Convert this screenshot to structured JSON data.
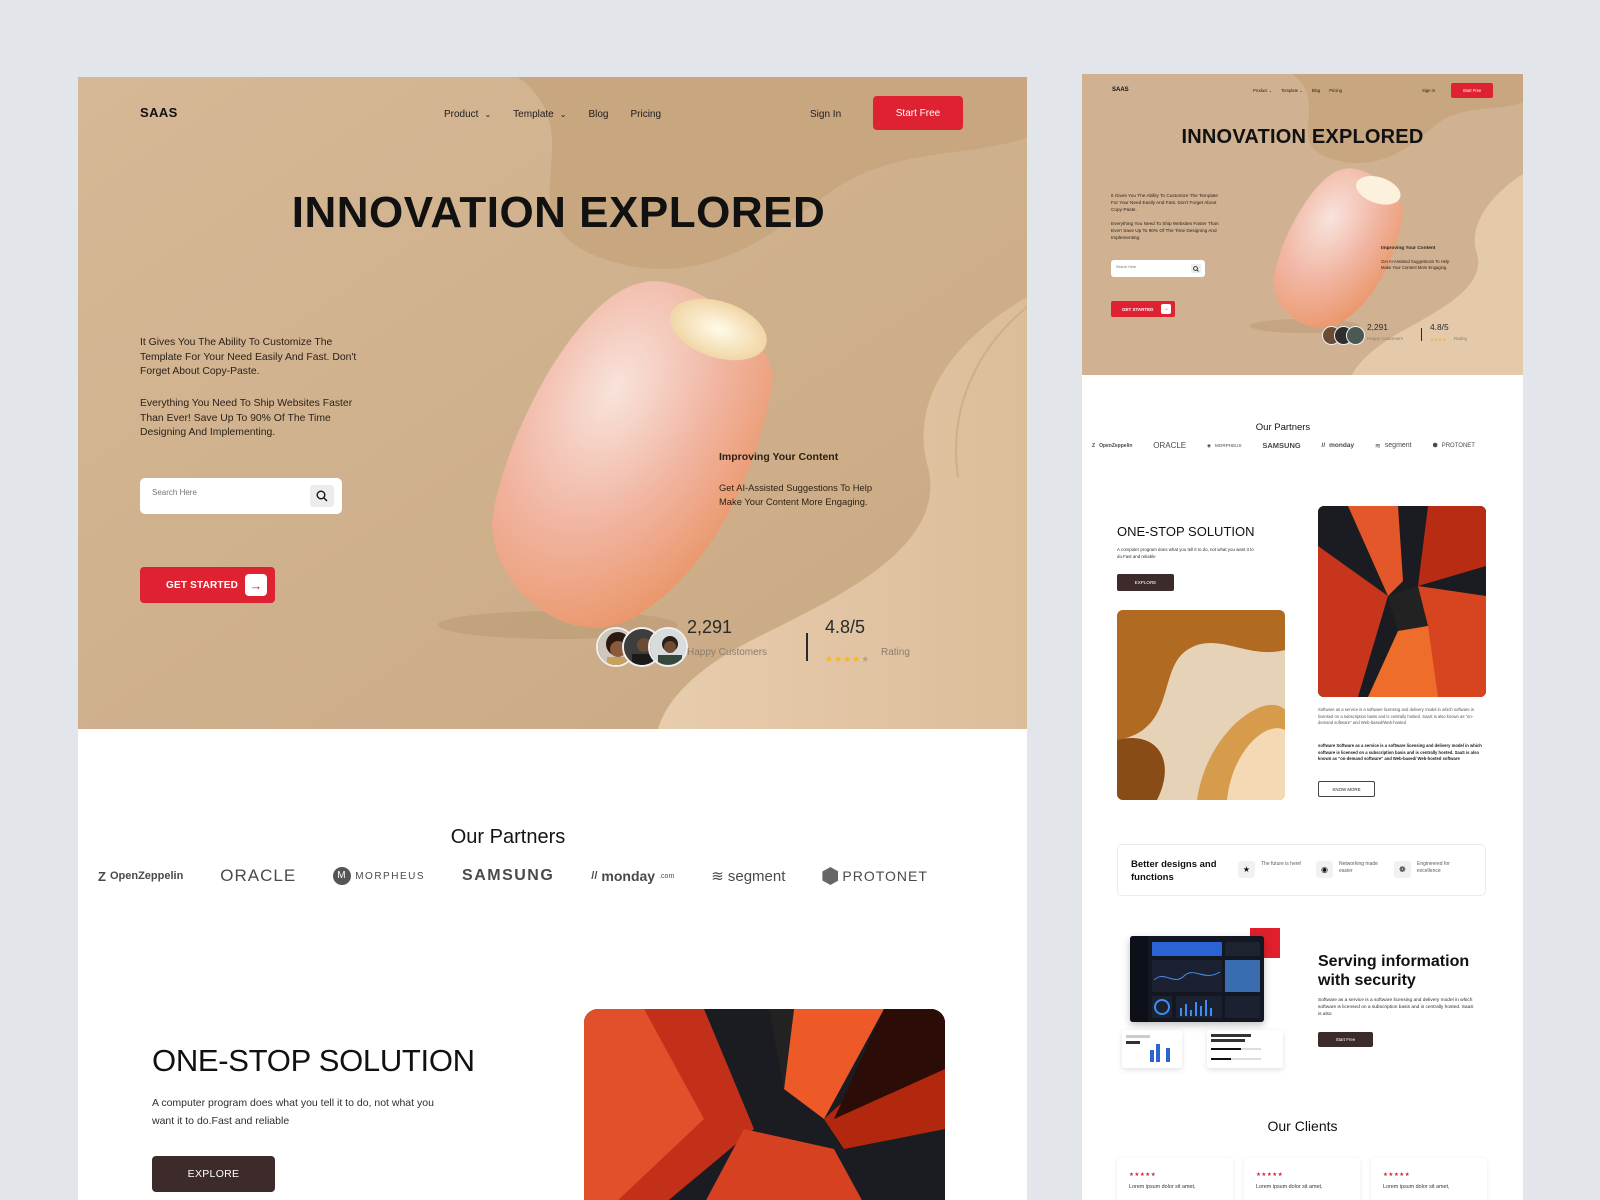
{
  "colors": {
    "accent": "#df2231",
    "hero_bg": "#d0b292",
    "dark_button": "#3d2b2b",
    "star": "#f3b82a"
  },
  "nav": {
    "logo": "SAAS",
    "links": [
      {
        "label": "Product",
        "icon": "chevron-down-icon"
      },
      {
        "label": "Template",
        "icon": "chevron-down-icon"
      },
      {
        "label": "Blog"
      },
      {
        "label": "Pricing"
      }
    ],
    "sign_in": "Sign In",
    "start_free": "Start Free"
  },
  "hero": {
    "title": "INNOVATION EXPLORED",
    "para1": "It Gives You The Ability To Customize The Template For Your Need Easily And Fast. Don't Forget About Copy-Paste.",
    "para2": "Everything You Need To Ship Websites Faster Than Ever! Save Up To 90% Of The Time Designing And Implementing.",
    "search_placeholder": "Search Here",
    "get_started": "GET STARTED",
    "improve_title": "Improving Your Content",
    "improve_text": "Get AI-Assisted Suggestions To Help Make Your Content More Engaging.",
    "customers_value": "2,291",
    "customers_label": "Happy Customers",
    "rating_value": "4.8/5",
    "rating_label": "Rating",
    "rating_stars": 4
  },
  "partners": {
    "title": "Our Partners",
    "logos": [
      "OpenZeppelin",
      "ORACLE",
      "MORPHEUS",
      "SAMSUNG",
      "monday",
      ".com",
      "segment",
      "PROTONET"
    ]
  },
  "onestop": {
    "title": "ONE-STOP SOLUTION",
    "text": "A computer program does what you tell it to do, not what you want it to do.Fast and reliable",
    "explore": "EXPLORE",
    "saas_text1": "Software as a service is a software licensing and delivery model in which software is licensed on a subscription basis and is centrally hosted. SaaS is also known as \"on-demand software\" and Web-based/Web-hosted",
    "saas_text2": "software Software as a service is a software licensing and delivery model in which software is licensed on a subscription basis and is centrally hosted. SaaS is also known as \"on-demand software\" and Web-based/ Web-hosted software",
    "know_more": "KNOW MORE"
  },
  "features": {
    "title": "Better designs and functions",
    "items": [
      {
        "icon": "star-icon",
        "text": "The future is here!"
      },
      {
        "icon": "lock-icon",
        "text": "Networking made easier"
      },
      {
        "icon": "bulb-icon",
        "text": "Engineered for excellence"
      }
    ]
  },
  "serving": {
    "title": "Serving information with security",
    "text": "Software as a service is a software licensing and delivery model in which software is licensed on a subscription basis and is centrally hosted. SaaS is also",
    "button": "Start Free"
  },
  "clients": {
    "title": "Our Clients",
    "cards": [
      {
        "stars": "★★★★★",
        "text": "Lorem ipsum dolor sit amet,"
      },
      {
        "stars": "★★★★★",
        "text": "Lorem ipsum dolor sit amet,"
      },
      {
        "stars": "★★★★★",
        "text": "Lorem ipsum dolor sit amet,"
      }
    ]
  }
}
